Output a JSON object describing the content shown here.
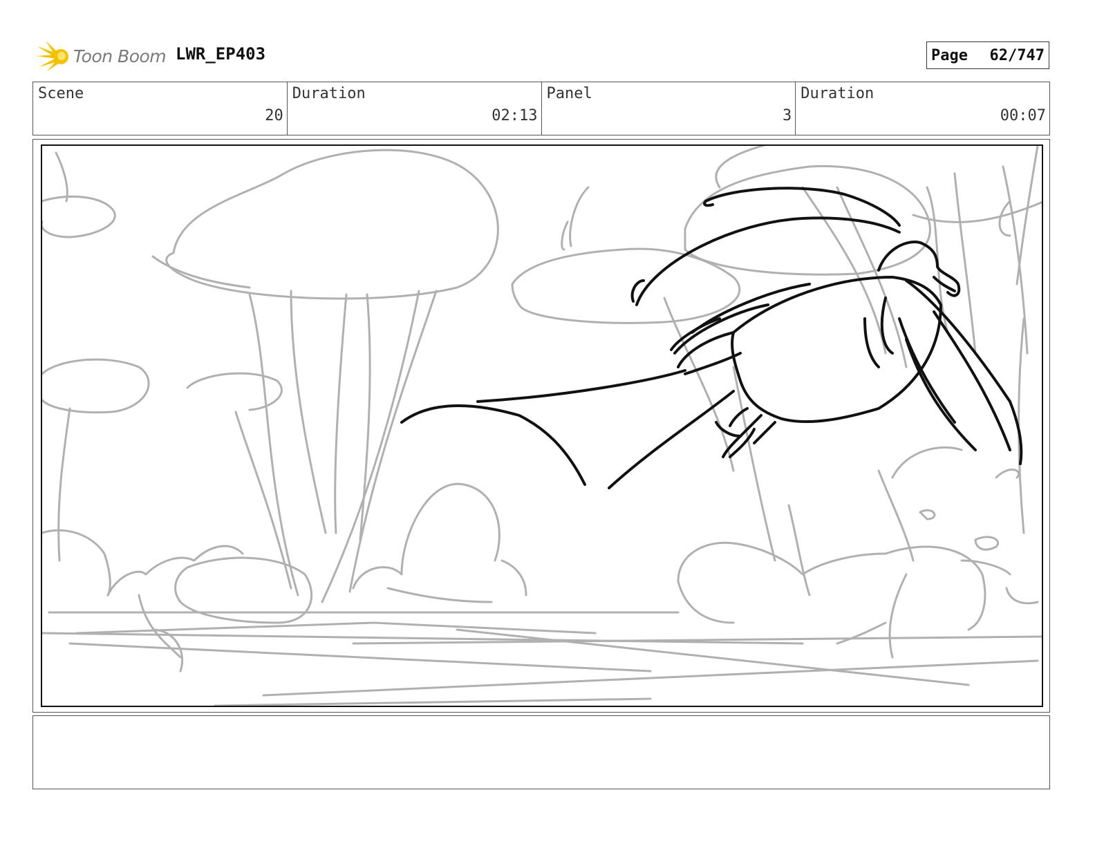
{
  "header": {
    "logo_text": "Toon Boom",
    "project": "LWR_EP403",
    "page_label": "Page",
    "page_value": "62/747"
  },
  "info": {
    "scene_label": "Scene",
    "scene_value": "20",
    "duration_label": "Duration",
    "duration_value": "02:13",
    "panel_label": "Panel",
    "panel_value": "3",
    "panel_duration_label": "Duration",
    "panel_duration_value": "00:07"
  },
  "colors": {
    "sketch_rough": "#b0b0b0",
    "sketch_ink": "#111111",
    "logo_accent": "#f2c200"
  },
  "notes": {
    "text": ""
  }
}
